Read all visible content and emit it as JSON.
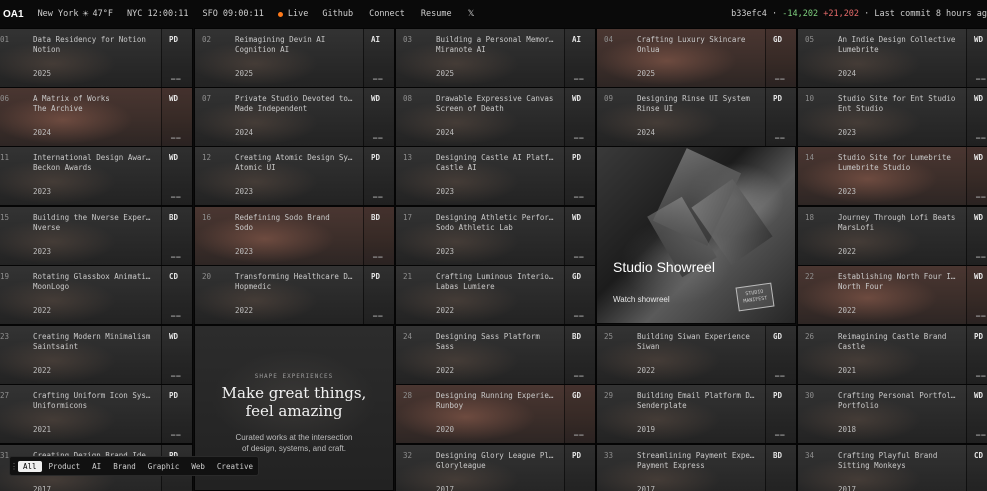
{
  "topbar": {
    "logo": "OA1",
    "location": "New York",
    "weather_icon": "sun-icon",
    "temperature": "47°F",
    "nyc_time": "NYC 12:00:11",
    "sfo_time": "SFO 09:00:11",
    "live_label": "Live",
    "nav": [
      "Github",
      "Connect",
      "Resume",
      "𝕏"
    ],
    "commit_hash": "b33efc4",
    "deletions": "-14,202",
    "additions": "+21,202",
    "last_commit": "Last commit 8 hours ag",
    "live_dot_color": "#ff7a1a"
  },
  "projects": [
    {
      "num": "01",
      "title": "Data Residency for Notion",
      "client": "Notion",
      "year": "2025",
      "tag": "PD"
    },
    {
      "num": "02",
      "title": "Reimagining Devin AI",
      "client": "Cognition AI",
      "year": "2025",
      "tag": "AI"
    },
    {
      "num": "03",
      "title": "Building a Personal Memory...",
      "client": "Miranote AI",
      "year": "2025",
      "tag": "AI"
    },
    {
      "num": "04",
      "title": "Crafting Luxury Skincare",
      "client": "Onlua",
      "year": "2025",
      "tag": "GD"
    },
    {
      "num": "05",
      "title": "An Indie Design Collective",
      "client": "Lumebrite",
      "year": "2024",
      "tag": "WD"
    },
    {
      "num": "06",
      "title": "A Matrix of Works",
      "client": "The Archive",
      "year": "2024",
      "tag": "WD"
    },
    {
      "num": "07",
      "title": "Private Studio Devoted to ...",
      "client": "Made Independent",
      "year": "2024",
      "tag": "WD"
    },
    {
      "num": "08",
      "title": "Drawable Expressive Canvas",
      "client": "Screen of Death",
      "year": "2024",
      "tag": "WD"
    },
    {
      "num": "09",
      "title": "Designing Rinse UI System",
      "client": "Rinse UI",
      "year": "2024",
      "tag": "PD"
    },
    {
      "num": "10",
      "title": "Studio Site for Ent Studio",
      "client": "Ent Studio",
      "year": "2023",
      "tag": "WD"
    },
    {
      "num": "11",
      "title": "International Design Awards",
      "client": "Beckon Awards",
      "year": "2023",
      "tag": "WD"
    },
    {
      "num": "12",
      "title": "Creating Atomic Design Sys...",
      "client": "Atomic UI",
      "year": "2023",
      "tag": "PD"
    },
    {
      "num": "13",
      "title": "Designing Castle AI Platfo...",
      "client": "Castle AI",
      "year": "2023",
      "tag": "PD"
    },
    {
      "num": "14",
      "title": "Studio Site for Lumebrite",
      "client": "Lumebrite Studio",
      "year": "2023",
      "tag": "WD"
    },
    {
      "num": "15",
      "title": "Building the Nverse Experi...",
      "client": "Nverse",
      "year": "2023",
      "tag": "BD"
    },
    {
      "num": "16",
      "title": "Redefining Sodo Brand",
      "client": "Sodo",
      "year": "2023",
      "tag": "BD"
    },
    {
      "num": "17",
      "title": "Designing Athletic Perform...",
      "client": "Sodo Athletic Lab",
      "year": "2023",
      "tag": "WD"
    },
    {
      "num": "18",
      "title": "Journey Through Lofi Beats",
      "client": "MarsLofi",
      "year": "2022",
      "tag": "WD"
    },
    {
      "num": "19",
      "title": "Rotating Glassbox Animation",
      "client": "MoonLogo",
      "year": "2022",
      "tag": "CD"
    },
    {
      "num": "20",
      "title": "Transforming Healthcare De...",
      "client": "Hopmedic",
      "year": "2022",
      "tag": "PD"
    },
    {
      "num": "21",
      "title": "Crafting Luminous Interiors",
      "client": "Labas Lumiere",
      "year": "2022",
      "tag": "GD"
    },
    {
      "num": "22",
      "title": "Establishing North Four Id...",
      "client": "North Four",
      "year": "2022",
      "tag": "WD"
    },
    {
      "num": "23",
      "title": "Creating Modern Minimalism",
      "client": "Saintsaint",
      "year": "2022",
      "tag": "WD"
    },
    {
      "num": "24",
      "title": "Designing Sass Platform",
      "client": "Sass",
      "year": "2022",
      "tag": "BD"
    },
    {
      "num": "25",
      "title": "Building Siwan Experience",
      "client": "Siwan",
      "year": "2022",
      "tag": "GD"
    },
    {
      "num": "26",
      "title": "Reimagining Castle Brand",
      "client": "Castle",
      "year": "2021",
      "tag": "PD"
    },
    {
      "num": "27",
      "title": "Crafting Uniform Icon Syst...",
      "client": "Uniformicons",
      "year": "2021",
      "tag": "PD"
    },
    {
      "num": "28",
      "title": "Designing Running Experien...",
      "client": "Runboy",
      "year": "2020",
      "tag": "GD"
    },
    {
      "num": "29",
      "title": "Building Email Platform De...",
      "client": "Senderplate",
      "year": "2019",
      "tag": "PD"
    },
    {
      "num": "30",
      "title": "Crafting Personal Portfolio",
      "client": "Portfolio",
      "year": "2018",
      "tag": "WD"
    },
    {
      "num": "31",
      "title": "Creating Dezign Brand Iden...",
      "client": "",
      "year": "2017",
      "tag": "PD"
    },
    {
      "num": "32",
      "title": "Designing Glory League Pla...",
      "client": "Gloryleague",
      "year": "2017",
      "tag": "PD"
    },
    {
      "num": "33",
      "title": "Streamlining Payment Exper...",
      "client": "Payment Express",
      "year": "2017",
      "tag": "BD"
    },
    {
      "num": "34",
      "title": "Crafting Playful Brand",
      "client": "Sitting Monkeys",
      "year": "2017",
      "tag": "CD"
    }
  ],
  "showreel": {
    "title": "Studio Showreel",
    "watch_label": "Watch showreel",
    "stamp_text": "STUDIO MANIFEST"
  },
  "hero": {
    "eyebrow": "SHAPE EXPERIENCES",
    "headline_line1": "Make great things,",
    "headline_line2": "feel amazing",
    "sub_line1": "Curated works at the intersection",
    "sub_line2": "of design, systems, and craft."
  },
  "filters": {
    "items": [
      "All",
      "Product",
      "AI",
      "Brand",
      "Graphic",
      "Web",
      "Creative"
    ],
    "active": "All"
  }
}
